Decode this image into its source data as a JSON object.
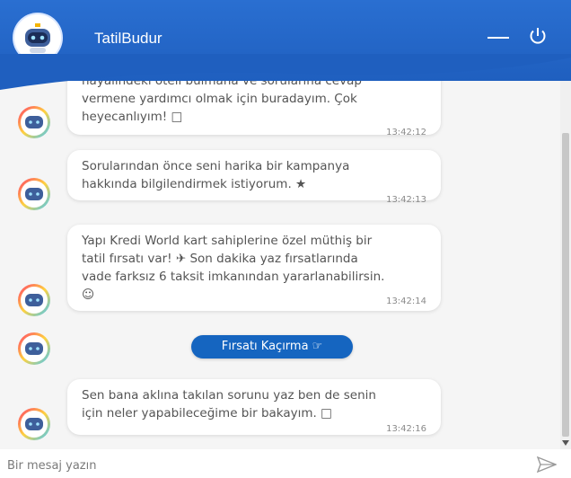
{
  "header": {
    "title": "TatilBudur",
    "minimize_icon": "minimize-icon",
    "power_icon": "power-icon",
    "bg": "#2a6fd1"
  },
  "messages": [
    {
      "text_line1": "hayalindeki oteli bulmana ve sorularına cevap",
      "text_line2": "vermene yardımcı olmak için buradayım. Çok",
      "text_line3": "heyecanlıyım! □",
      "time": "13:42:12"
    },
    {
      "text_line1": "Sorularından önce seni harika bir kampanya",
      "text_line2": "hakkında bilgilendirmek istiyorum. ★",
      "time": "13:42:13"
    },
    {
      "text_line1": "Yapı Kredi World kart sahiplerine özel müthiş bir",
      "text_line2": "tatil fırsatı var! ✈ Son dakika yaz fırsatlarında",
      "text_line3": "vade farksız 6 taksit imkanından yararlanabilirsin.",
      "text_line4": "☺",
      "time": "13:42:14"
    },
    {
      "text_line1": "Sen bana aklına takılan sorunu yaz ben de senin",
      "text_line2": "için neler yapabileceğime bir bakayım. □",
      "time": "13:42:16"
    }
  ],
  "cta": {
    "label": "Fırsatı Kaçırma",
    "icon": "☞",
    "color": "#1565c0"
  },
  "input": {
    "placeholder": "Bir mesaj yazın",
    "value": ""
  },
  "send_icon": "send-icon"
}
